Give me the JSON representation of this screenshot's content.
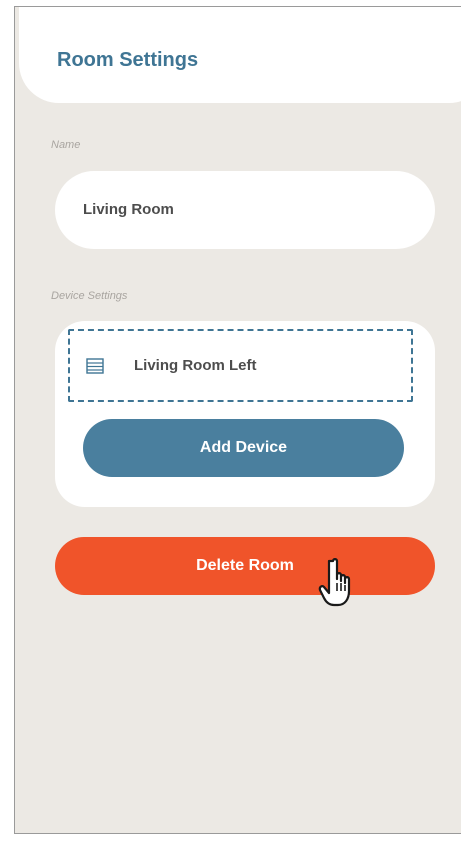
{
  "header": {
    "title": "Room Settings"
  },
  "name_section": {
    "label": "Name",
    "value": "Living Room"
  },
  "device_section": {
    "label": "Device Settings",
    "devices": [
      {
        "label": "Living Room Left",
        "icon": "blinds-icon"
      }
    ],
    "add_button_label": "Add Device"
  },
  "delete_button_label": "Delete Room",
  "colors": {
    "background": "#ece9e4",
    "accent": "#3f7594",
    "add_button": "#4a7f9e",
    "delete_button": "#f0542a"
  },
  "cursor": {
    "icon": "hand-pointer-icon"
  }
}
